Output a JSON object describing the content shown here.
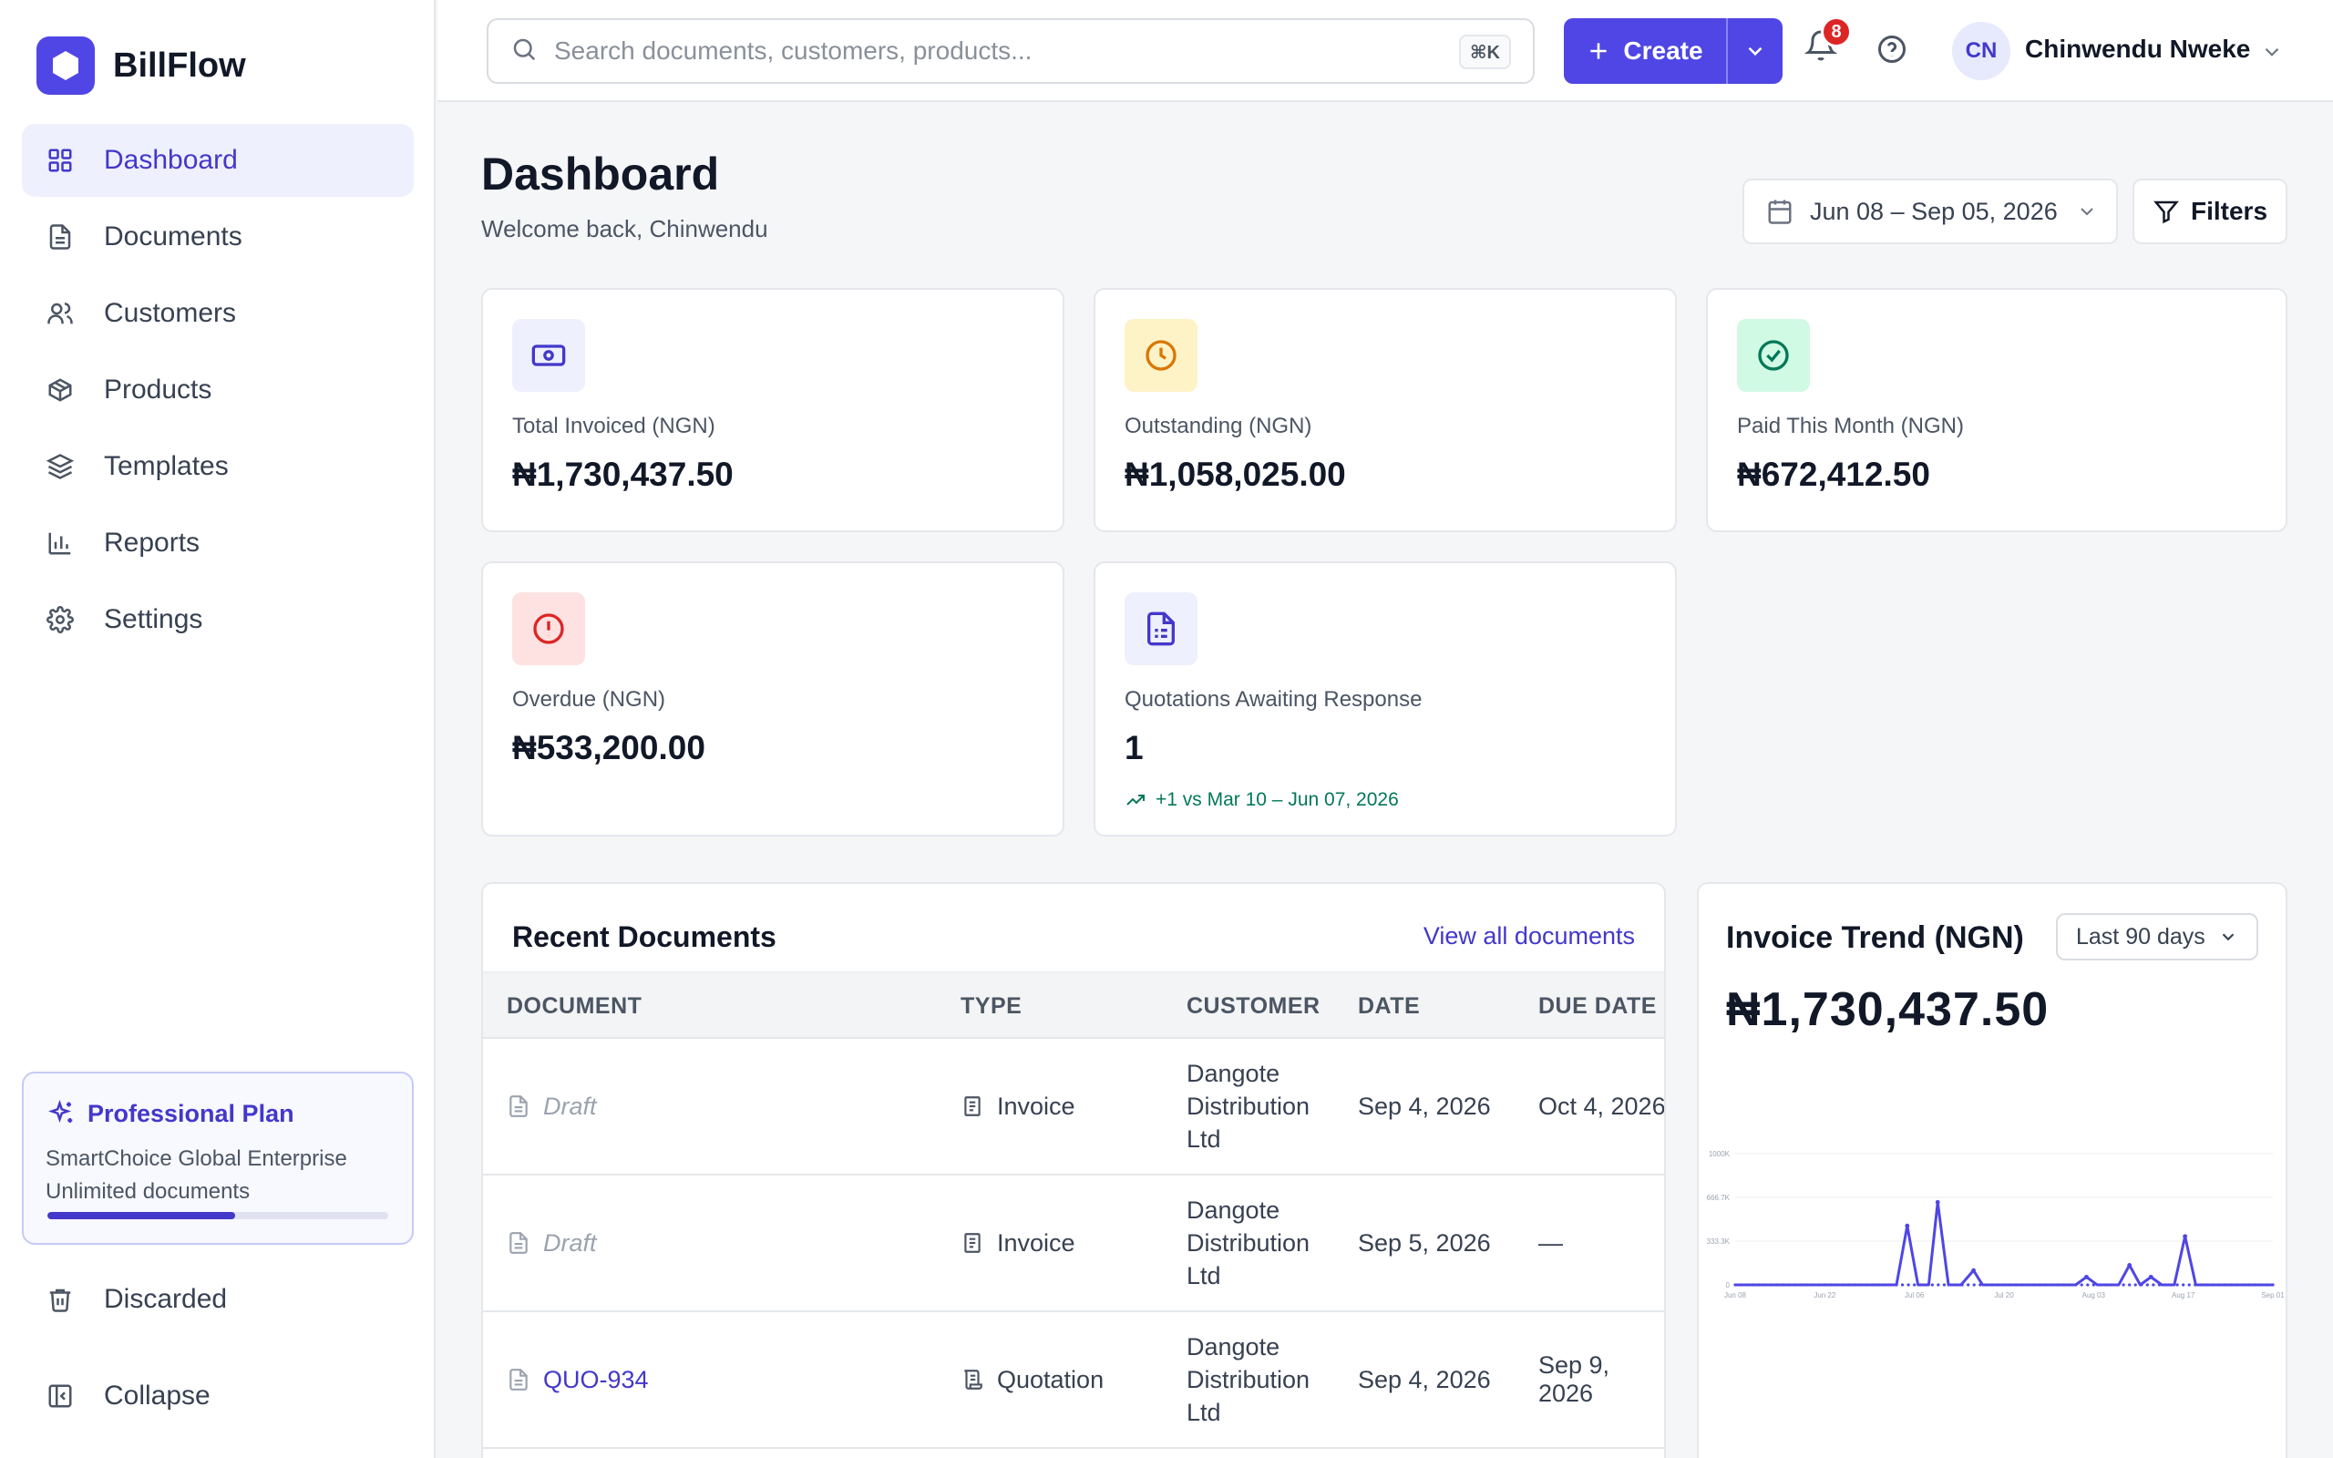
{
  "app": {
    "name": "BillFlow",
    "brand_color": "#4f46e5"
  },
  "sidebar": {
    "items": [
      {
        "label": "Dashboard",
        "icon": "grid-icon",
        "active": true
      },
      {
        "label": "Documents",
        "icon": "file-icon"
      },
      {
        "label": "Customers",
        "icon": "users-icon"
      },
      {
        "label": "Products",
        "icon": "box-icon"
      },
      {
        "label": "Templates",
        "icon": "layers-icon"
      },
      {
        "label": "Reports",
        "icon": "bar-chart-icon"
      },
      {
        "label": "Settings",
        "icon": "gear-icon"
      }
    ],
    "plan": {
      "title": "Professional Plan",
      "company": "SmartChoice Global Enterprise",
      "limit": "Unlimited documents",
      "usage_fraction": 0.55
    },
    "discarded": "Discarded",
    "collapse": "Collapse"
  },
  "header": {
    "search_placeholder": "Search documents, customers, products...",
    "shortcut": "⌘K",
    "create_label": "Create",
    "notification_count": "8",
    "user": {
      "initials": "CN",
      "name": "Chinwendu Nweke"
    }
  },
  "page": {
    "title": "Dashboard",
    "subtitle": "Welcome back, Chinwendu",
    "date_range": "Jun 08 – Sep 05, 2026",
    "filters_label": "Filters"
  },
  "stats": [
    {
      "label": "Total Invoiced (NGN)",
      "value": "₦1,730,437.50",
      "icon": "cash-icon",
      "color": "#4338ca",
      "bg": "#eef0fd"
    },
    {
      "label": "Outstanding (NGN)",
      "value": "₦1,058,025.00",
      "icon": "clock-icon",
      "color": "#d97706",
      "bg": "#fef3c7"
    },
    {
      "label": "Paid This Month (NGN)",
      "value": "₦672,412.50",
      "icon": "check-circle-icon",
      "color": "#047857",
      "bg": "#d1fae5"
    },
    {
      "label": "Overdue (NGN)",
      "value": "₦533,200.00",
      "icon": "alert-circle-icon",
      "color": "#dc2626",
      "bg": "#fee2e2"
    },
    {
      "label": "Quotations Awaiting Response",
      "value": "1",
      "trend": "+1 vs Mar 10 – Jun 07, 2026",
      "icon": "document-list-icon",
      "color": "#4338ca",
      "bg": "#eef0fd"
    }
  ],
  "recent_documents": {
    "title": "Recent Documents",
    "view_all": "View all documents",
    "columns": [
      "DOCUMENT",
      "TYPE",
      "CUSTOMER",
      "DATE",
      "DUE DATE"
    ],
    "rows": [
      {
        "document": "Draft",
        "is_draft": true,
        "type": "Invoice",
        "customer": "Dangote Distribution Ltd",
        "date": "Sep 4, 2026",
        "due": "Oct 4, 2026"
      },
      {
        "document": "Draft",
        "is_draft": true,
        "type": "Invoice",
        "customer": "Dangote Distribution Ltd",
        "date": "Sep 5, 2026",
        "due": "—"
      },
      {
        "document": "QUO-934",
        "is_draft": false,
        "type": "Quotation",
        "customer": "Dangote Distribution Ltd",
        "date": "Sep 4, 2026",
        "due": "Sep 9, 2026"
      }
    ]
  },
  "invoice_trend": {
    "title": "Invoice Trend (NGN)",
    "period": "Last 90 days",
    "total": "₦1,730,437.50"
  },
  "chart_data": {
    "type": "line",
    "title": "Invoice Trend (NGN)",
    "y_ticks": [
      "1000K",
      "666.7K",
      "333.3K",
      "0"
    ],
    "x_ticks": [
      "Jun 08",
      "Jun 22",
      "Jul 06",
      "Jul 20",
      "Aug 03",
      "Aug 17",
      "Sep 01"
    ],
    "ylim": [
      0,
      1000000
    ],
    "x": [
      "Jun 08",
      "Jun 11",
      "Jun 14",
      "Jun 17",
      "Jun 20",
      "Jun 23",
      "Jun 26",
      "Jun 29",
      "Jul 02",
      "Jul 05",
      "Jul 08",
      "Jul 11",
      "Jul 14",
      "Jul 17",
      "Jul 20",
      "Jul 23",
      "Jul 26",
      "Jul 29",
      "Aug 01",
      "Aug 04",
      "Aug 07",
      "Aug 10",
      "Aug 13",
      "Aug 16",
      "Aug 19",
      "Aug 22",
      "Aug 25",
      "Aug 28",
      "Aug 31",
      "Sep 03",
      "Sep 05"
    ],
    "values": [
      0,
      0,
      0,
      0,
      0,
      0,
      0,
      0,
      0,
      0,
      0,
      0,
      0,
      0,
      0,
      0,
      0,
      0,
      0,
      0,
      0,
      0,
      0,
      0,
      0,
      0,
      0,
      0,
      0,
      0,
      0
    ],
    "points": [
      {
        "x": 0,
        "y": 0
      },
      {
        "x": 6,
        "y": 0
      },
      {
        "x": 8,
        "y": 0
      },
      {
        "x": 9,
        "y": 0
      },
      {
        "x": 9.6,
        "y": 450000
      },
      {
        "x": 10.2,
        "y": 0
      },
      {
        "x": 10.8,
        "y": 0
      },
      {
        "x": 11.3,
        "y": 630000
      },
      {
        "x": 11.9,
        "y": 0
      },
      {
        "x": 12.6,
        "y": 0
      },
      {
        "x": 13.3,
        "y": 110000
      },
      {
        "x": 13.8,
        "y": 0
      },
      {
        "x": 19,
        "y": 0
      },
      {
        "x": 19.6,
        "y": 60000
      },
      {
        "x": 20.2,
        "y": 0
      },
      {
        "x": 21.4,
        "y": 0
      },
      {
        "x": 22,
        "y": 150000
      },
      {
        "x": 22.6,
        "y": 0
      },
      {
        "x": 23.2,
        "y": 60000
      },
      {
        "x": 23.8,
        "y": 0
      },
      {
        "x": 24.5,
        "y": 0
      },
      {
        "x": 25.1,
        "y": 370000
      },
      {
        "x": 25.7,
        "y": 0
      },
      {
        "x": 30,
        "y": 0
      }
    ],
    "series_color": "#4f46e5",
    "grid": true
  }
}
